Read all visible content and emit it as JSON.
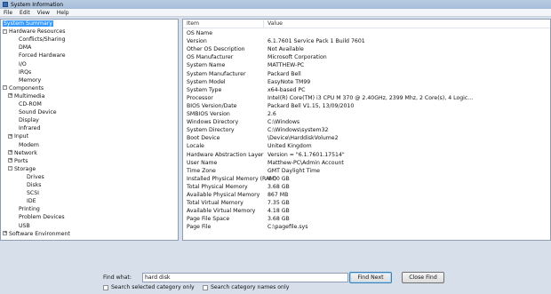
{
  "window": {
    "title": "System Information"
  },
  "menu": [
    "File",
    "Edit",
    "View",
    "Help"
  ],
  "tree": [
    {
      "label": "System Summary",
      "level": 0,
      "selected": true,
      "toggle": ""
    },
    {
      "label": "Hardware Resources",
      "level": 0,
      "toggle": "-"
    },
    {
      "label": "Conflicts/Sharing",
      "level": 2,
      "toggle": ""
    },
    {
      "label": "DMA",
      "level": 2,
      "toggle": ""
    },
    {
      "label": "Forced Hardware",
      "level": 2,
      "toggle": ""
    },
    {
      "label": "I/O",
      "level": 2,
      "toggle": ""
    },
    {
      "label": "IRQs",
      "level": 2,
      "toggle": ""
    },
    {
      "label": "Memory",
      "level": 2,
      "toggle": ""
    },
    {
      "label": "Components",
      "level": 0,
      "toggle": "-"
    },
    {
      "label": "Multimedia",
      "level": 1,
      "toggle": "+"
    },
    {
      "label": "CD-ROM",
      "level": 2,
      "toggle": ""
    },
    {
      "label": "Sound Device",
      "level": 2,
      "toggle": ""
    },
    {
      "label": "Display",
      "level": 2,
      "toggle": ""
    },
    {
      "label": "Infrared",
      "level": 2,
      "toggle": ""
    },
    {
      "label": "Input",
      "level": 1,
      "toggle": "+"
    },
    {
      "label": "Modem",
      "level": 2,
      "toggle": ""
    },
    {
      "label": "Network",
      "level": 1,
      "toggle": "+"
    },
    {
      "label": "Ports",
      "level": 1,
      "toggle": "+"
    },
    {
      "label": "Storage",
      "level": 1,
      "toggle": "-"
    },
    {
      "label": "Drives",
      "level": 3,
      "toggle": ""
    },
    {
      "label": "Disks",
      "level": 3,
      "toggle": ""
    },
    {
      "label": "SCSI",
      "level": 3,
      "toggle": ""
    },
    {
      "label": "IDE",
      "level": 3,
      "toggle": ""
    },
    {
      "label": "Printing",
      "level": 2,
      "toggle": ""
    },
    {
      "label": "Problem Devices",
      "level": 2,
      "toggle": ""
    },
    {
      "label": "USB",
      "level": 2,
      "toggle": ""
    },
    {
      "label": "Software Environment",
      "level": 0,
      "toggle": "+"
    }
  ],
  "details": {
    "columns": [
      "Item",
      "Value"
    ],
    "rows": [
      [
        "OS Name",
        ""
      ],
      [
        "Version",
        "6.1.7601 Service Pack 1 Build 7601"
      ],
      [
        "Other OS Description",
        "Not Available"
      ],
      [
        "OS Manufacturer",
        "Microsoft Corporation"
      ],
      [
        "System Name",
        "MATTHEW-PC"
      ],
      [
        "System Manufacturer",
        "Packard Bell"
      ],
      [
        "System Model",
        "EasyNote TM99"
      ],
      [
        "System Type",
        "x64-based PC"
      ],
      [
        "Processor",
        "Intel(R) Core(TM) i3 CPU        M 370  @ 2.40GHz, 2399 Mhz, 2 Core(s), 4 Logic..."
      ],
      [
        "BIOS Version/Date",
        "Packard Bell V1.15, 13/09/2010"
      ],
      [
        "SMBIOS Version",
        "2.6"
      ],
      [
        "Windows Directory",
        "C:\\Windows"
      ],
      [
        "System Directory",
        "C:\\Windows\\system32"
      ],
      [
        "Boot Device",
        "\\Device\\HarddiskVolume2"
      ],
      [
        "Locale",
        "United Kingdom"
      ],
      [
        "Hardware Abstraction Layer",
        "Version = \"6.1.7601.17514\""
      ],
      [
        "User Name",
        "Matthew-PC\\Admin Account"
      ],
      [
        "Time Zone",
        "GMT Daylight Time"
      ],
      [
        "Installed Physical Memory (RAM)",
        "4.00 GB"
      ],
      [
        "Total Physical Memory",
        "3.68 GB"
      ],
      [
        "Available Physical Memory",
        "867 MB"
      ],
      [
        "Total Virtual Memory",
        "7.35 GB"
      ],
      [
        "Available Virtual Memory",
        "4.18 GB"
      ],
      [
        "Page File Space",
        "3.68 GB"
      ],
      [
        "Page File",
        "C:\\pagefile.sys"
      ]
    ]
  },
  "find": {
    "label": "Find what:",
    "value": "hard disk",
    "find_next": "Find Next",
    "close_find": "Close Find",
    "check_selected": "Search selected category only",
    "check_names": "Search category names only"
  }
}
